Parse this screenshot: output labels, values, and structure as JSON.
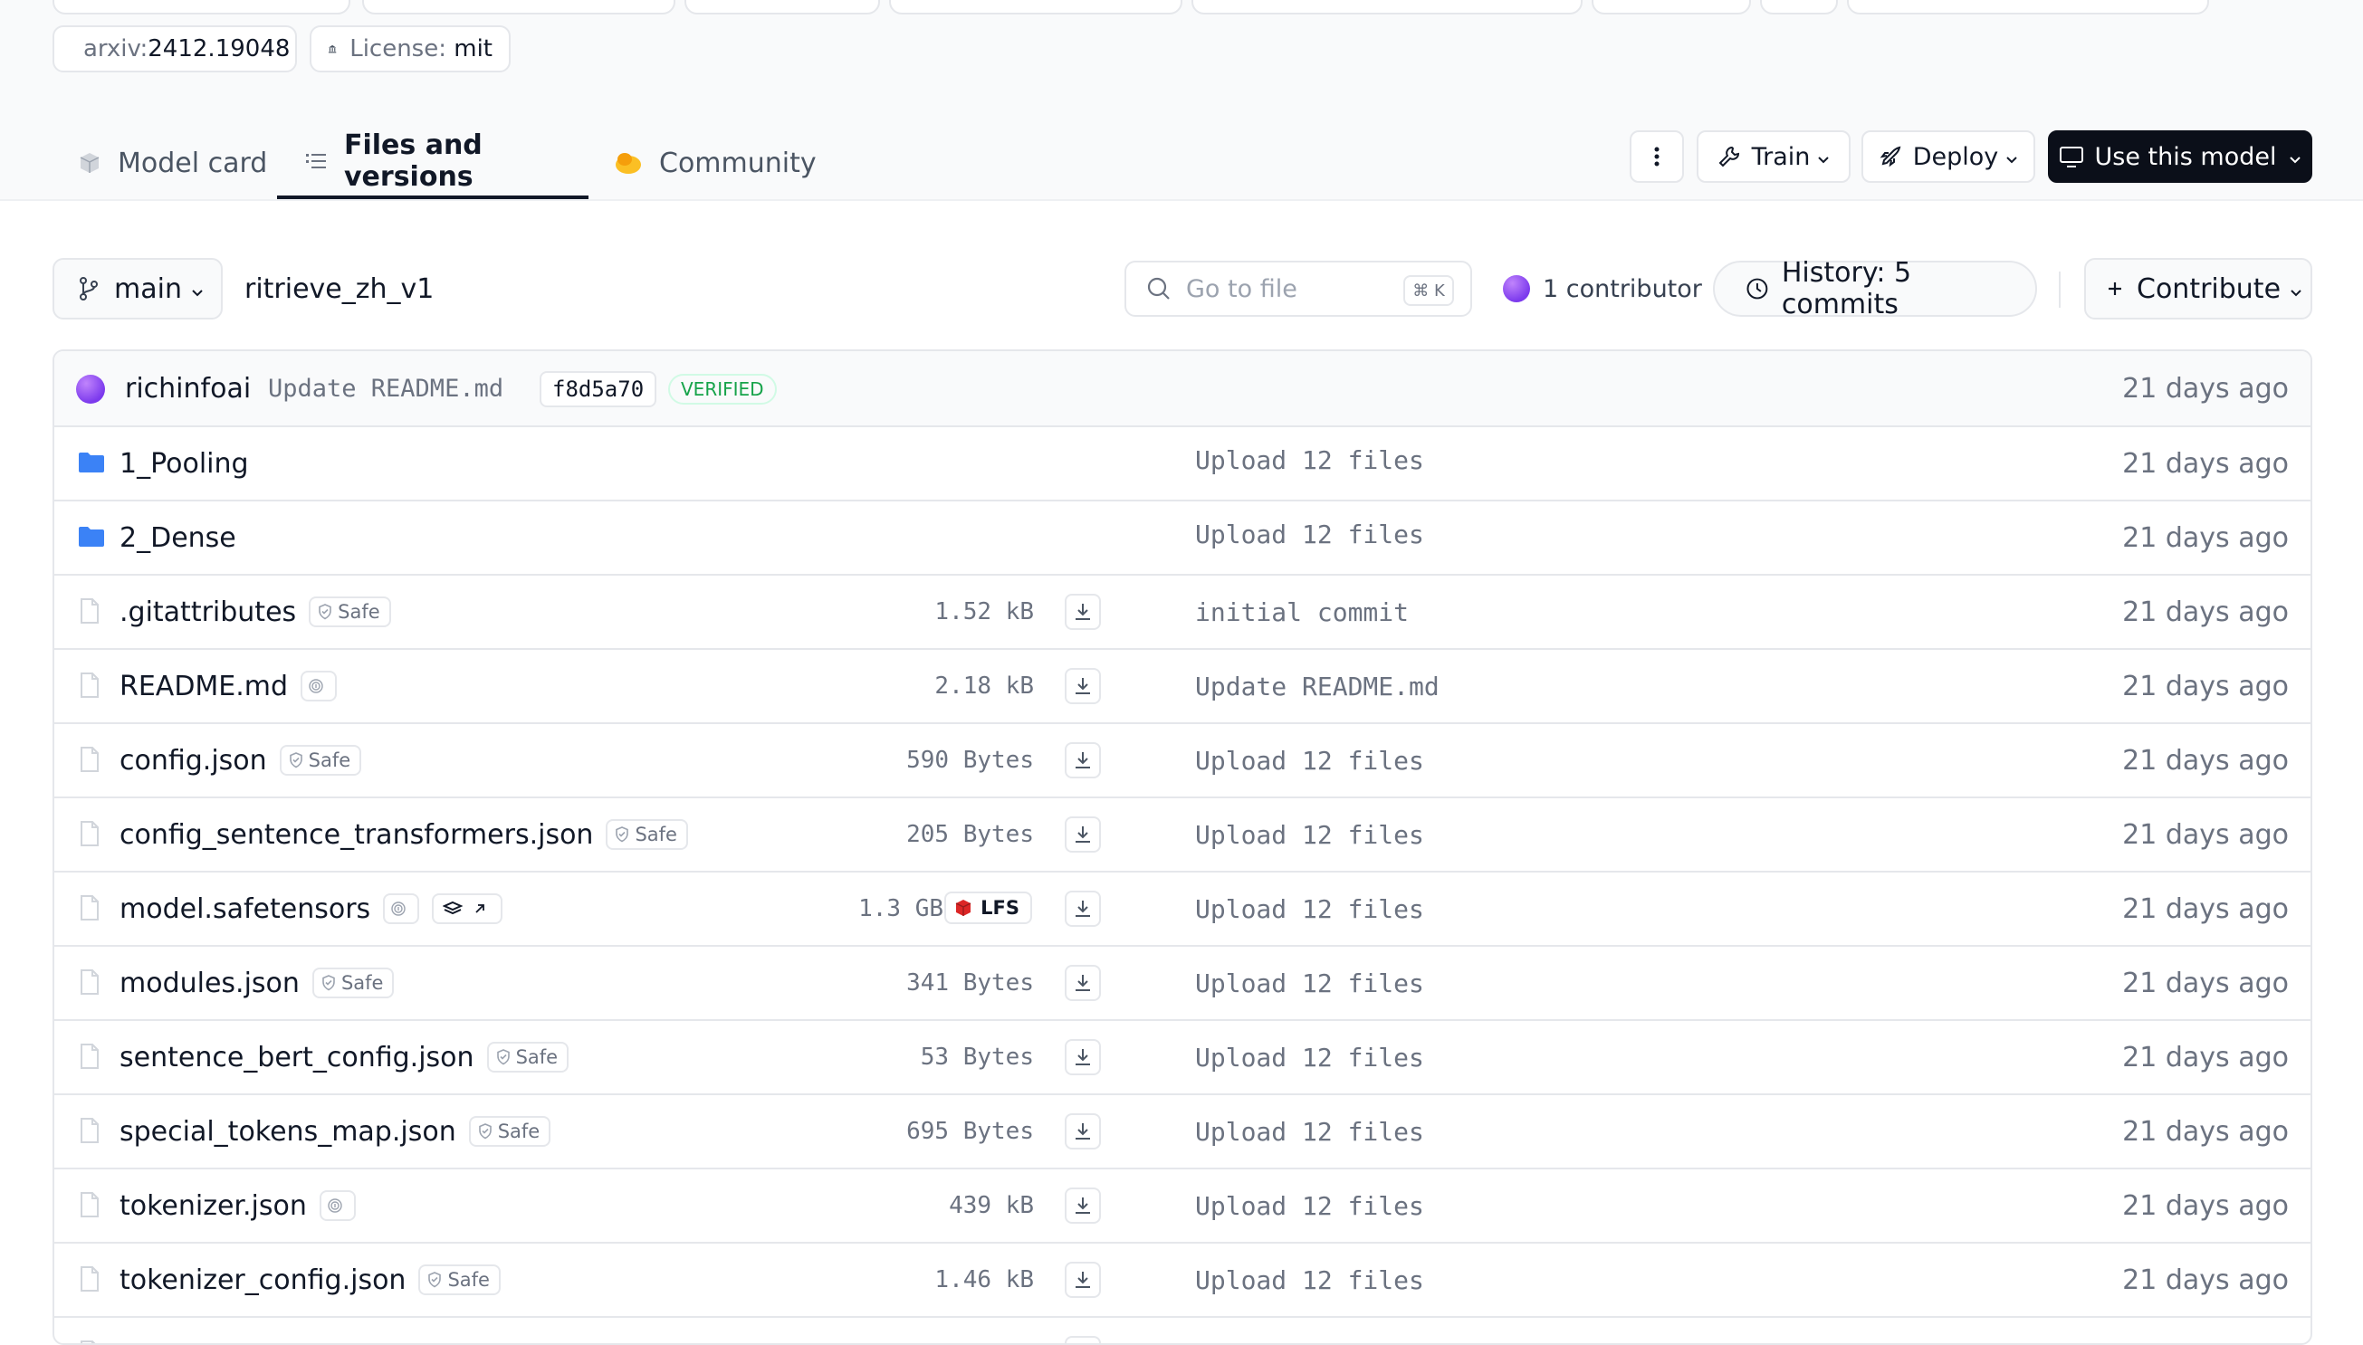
{
  "tags": {
    "arxiv_prefix": "arxiv:",
    "arxiv_id": "2412.19048",
    "license_prefix": "License:",
    "license_value": "mit"
  },
  "tabs": [
    {
      "label": "Model card",
      "icon": "cube-icon"
    },
    {
      "label": "Files and versions",
      "icon": "files-list-icon"
    },
    {
      "label": "Community",
      "icon": "community-icon"
    }
  ],
  "header_actions": {
    "train": "Train",
    "deploy": "Deploy",
    "use_model": "Use this model"
  },
  "toolbar": {
    "branch": "main",
    "path": "ritrieve_zh_v1",
    "search_placeholder": "Go to file",
    "search_shortcut": "⌘ K",
    "contributors": "1 contributor",
    "history": "History: 5 commits",
    "contribute": "Contribute"
  },
  "last_commit": {
    "author": "richinfoai",
    "message": "Update README.md",
    "hash": "f8d5a70",
    "verified": "VERIFIED",
    "date": "21 days ago"
  },
  "folders": [
    {
      "name": "1_Pooling",
      "commit": "Upload 12 files",
      "date": "21 days ago"
    },
    {
      "name": "2_Dense",
      "commit": "Upload 12 files",
      "date": "21 days ago"
    }
  ],
  "files": [
    {
      "name": ".gitattributes",
      "badge": "Safe",
      "size": "1.52 kB",
      "commit": "initial commit",
      "date": "21 days ago"
    },
    {
      "name": "README.md",
      "badge": "",
      "size": "2.18 kB",
      "commit": "Update README.md",
      "date": "21 days ago"
    },
    {
      "name": "config.json",
      "badge": "Safe",
      "size": "590 Bytes",
      "commit": "Upload 12 files",
      "date": "21 days ago"
    },
    {
      "name": "config_sentence_transformers.json",
      "badge": "Safe",
      "size": "205 Bytes",
      "commit": "Upload 12 files",
      "date": "21 days ago"
    },
    {
      "name": "model.safetensors",
      "badge": "",
      "size": "1.3 GB",
      "lfs": "LFS",
      "commit": "Upload 12 files",
      "date": "21 days ago"
    },
    {
      "name": "modules.json",
      "badge": "Safe",
      "size": "341 Bytes",
      "commit": "Upload 12 files",
      "date": "21 days ago"
    },
    {
      "name": "sentence_bert_config.json",
      "badge": "Safe",
      "size": "53 Bytes",
      "commit": "Upload 12 files",
      "date": "21 days ago"
    },
    {
      "name": "special_tokens_map.json",
      "badge": "Safe",
      "size": "695 Bytes",
      "commit": "Upload 12 files",
      "date": "21 days ago"
    },
    {
      "name": "tokenizer.json",
      "badge": "",
      "size": "439 kB",
      "commit": "Upload 12 files",
      "date": "21 days ago"
    },
    {
      "name": "tokenizer_config.json",
      "badge": "Safe",
      "size": "1.46 kB",
      "commit": "Upload 12 files",
      "date": "21 days ago"
    }
  ],
  "colors": {
    "accent_dark": "#0b0f19",
    "folder_blue": "#3b82f6",
    "verified_green": "#16a34a",
    "lfs_red": "#dc2626"
  }
}
